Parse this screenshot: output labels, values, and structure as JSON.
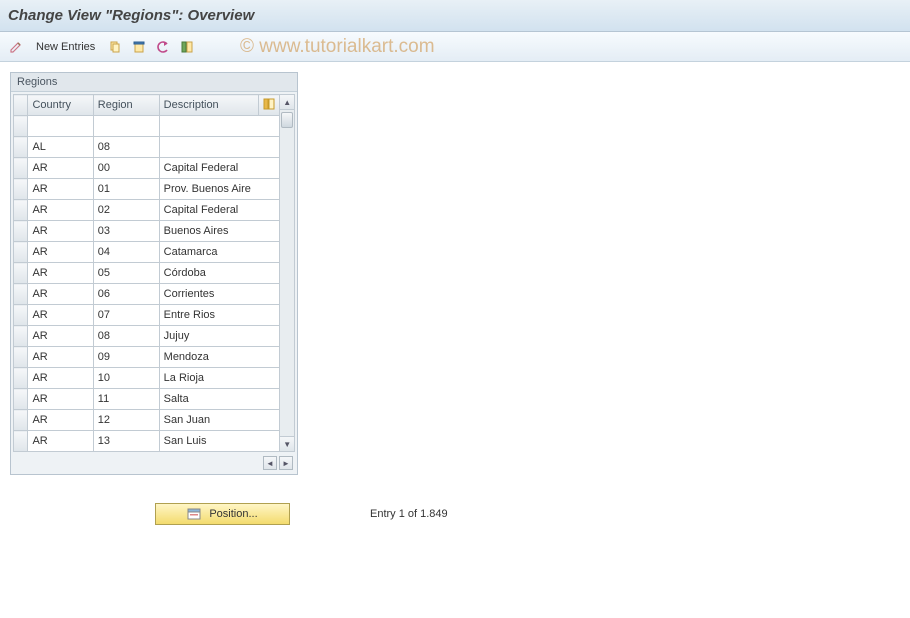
{
  "title": "Change View \"Regions\": Overview",
  "toolbar": {
    "new_entries": "New Entries"
  },
  "panel": {
    "title": "Regions",
    "headers": {
      "country": "Country",
      "region": "Region",
      "description": "Description"
    },
    "rows": [
      {
        "country": "",
        "region": "",
        "desc": ""
      },
      {
        "country": "AL",
        "region": "08",
        "desc": ""
      },
      {
        "country": "AR",
        "region": "00",
        "desc": "Capital Federal"
      },
      {
        "country": "AR",
        "region": "01",
        "desc": "Prov. Buenos Aire"
      },
      {
        "country": "AR",
        "region": "02",
        "desc": "Capital Federal"
      },
      {
        "country": "AR",
        "region": "03",
        "desc": "Buenos Aires"
      },
      {
        "country": "AR",
        "region": "04",
        "desc": "Catamarca"
      },
      {
        "country": "AR",
        "region": "05",
        "desc": "Córdoba"
      },
      {
        "country": "AR",
        "region": "06",
        "desc": "Corrientes"
      },
      {
        "country": "AR",
        "region": "07",
        "desc": "Entre Rios"
      },
      {
        "country": "AR",
        "region": "08",
        "desc": "Jujuy"
      },
      {
        "country": "AR",
        "region": "09",
        "desc": "Mendoza"
      },
      {
        "country": "AR",
        "region": "10",
        "desc": "La Rioja"
      },
      {
        "country": "AR",
        "region": "11",
        "desc": "Salta"
      },
      {
        "country": "AR",
        "region": "12",
        "desc": "San Juan"
      },
      {
        "country": "AR",
        "region": "13",
        "desc": "San Luis"
      }
    ]
  },
  "footer": {
    "position_label": "Position...",
    "entry_label": "Entry 1 of 1.849"
  },
  "watermark": "© www.tutorialkart.com"
}
